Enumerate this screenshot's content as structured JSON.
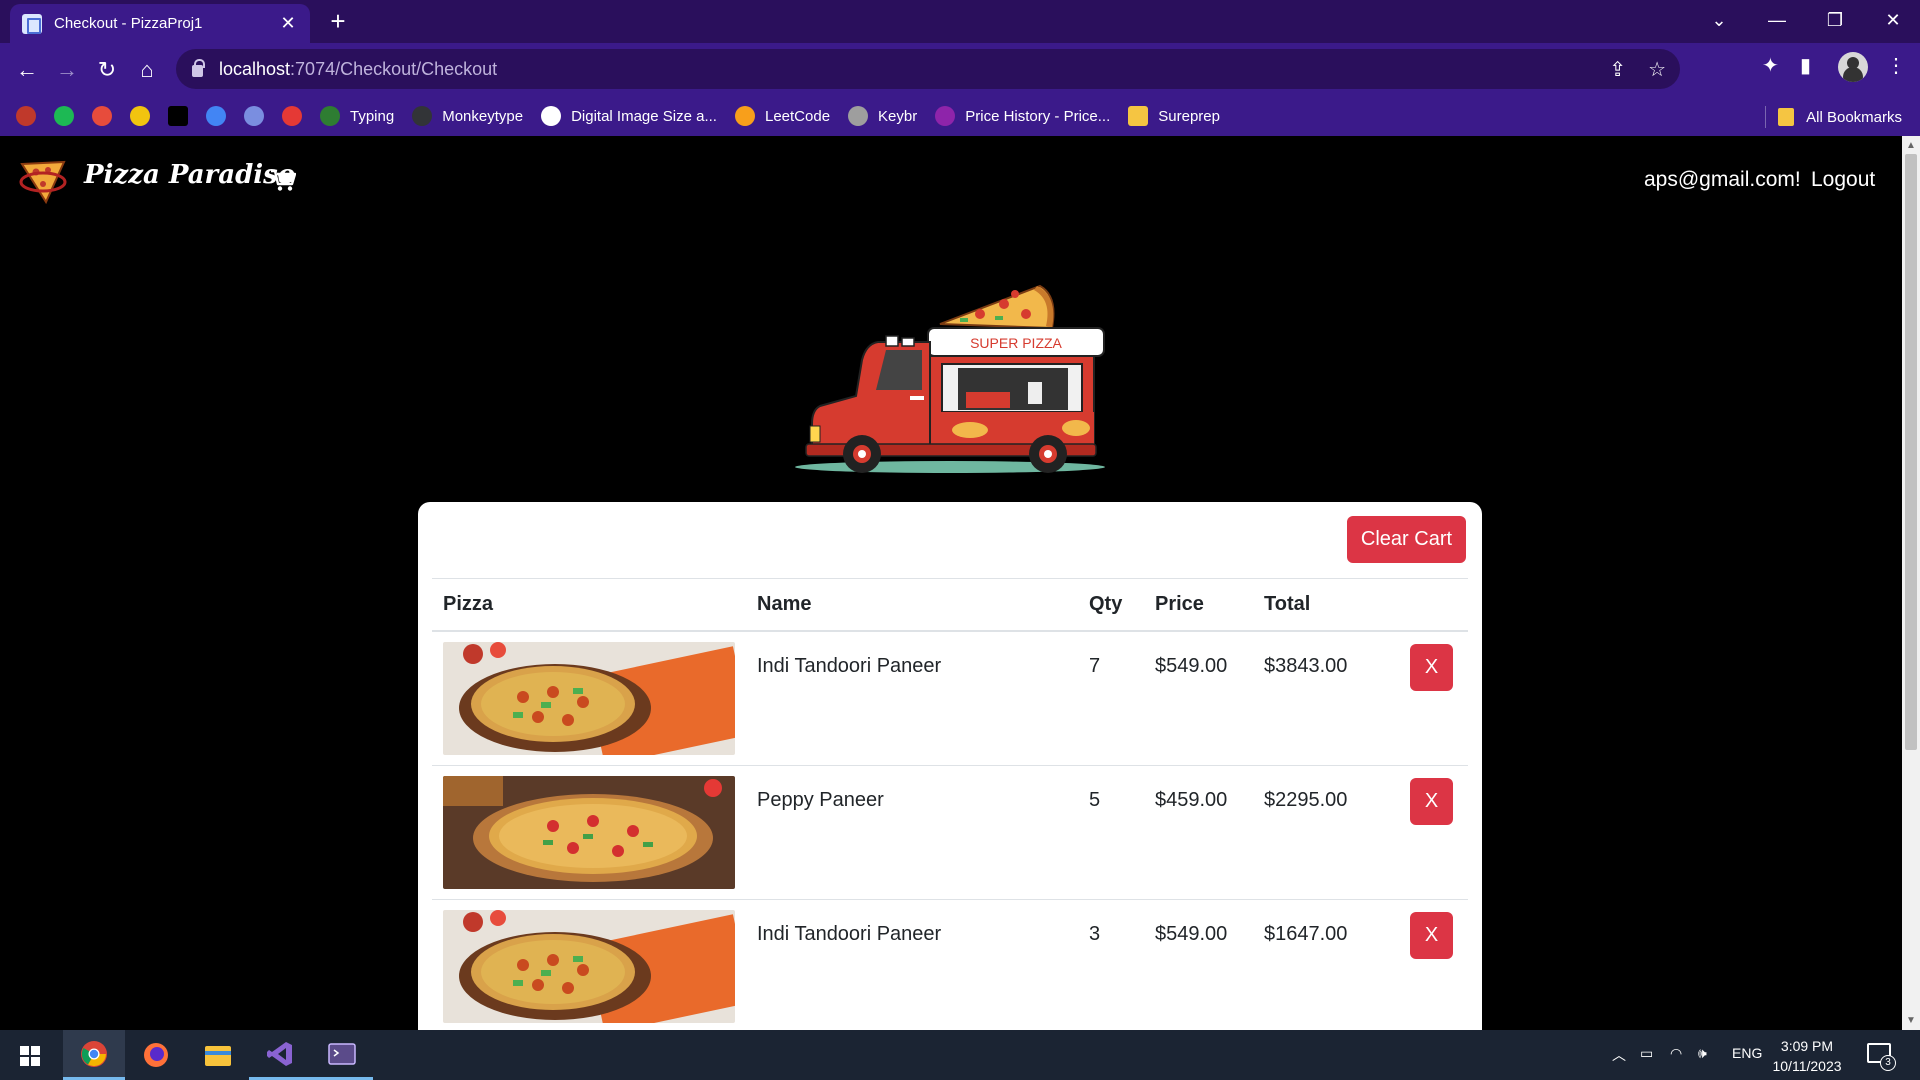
{
  "browser": {
    "tab_title": "Checkout - PizzaProj1",
    "url_host": "localhost",
    "url_path": ":7074/Checkout/Checkout",
    "bookmarks": [
      {
        "label": "",
        "color": "#c0392b",
        "icon": "chevron-icon"
      },
      {
        "label": "",
        "color": "#1db954",
        "icon": "spotify-icon"
      },
      {
        "label": "",
        "color": "#e74c3c",
        "icon": "store-icon"
      },
      {
        "label": "",
        "color": "#f1c40f",
        "icon": "flipkart-icon"
      },
      {
        "label": "",
        "color": "#000000",
        "icon": "amazon-icon"
      },
      {
        "label": "",
        "color": "#4285f4",
        "icon": "gsuite-icon"
      },
      {
        "label": "",
        "color": "#7a8ee0",
        "icon": "drop-icon"
      },
      {
        "label": "",
        "color": "#e53935",
        "icon": "gmail-icon"
      },
      {
        "label": "Typing",
        "color": "#2e7d32",
        "icon": "typing-icon"
      },
      {
        "label": "Monkeytype",
        "color": "#323437",
        "icon": "monkeytype-icon"
      },
      {
        "label": "Digital Image Size a...",
        "color": "#ffffff",
        "icon": "google-icon"
      },
      {
        "label": "LeetCode",
        "color": "#f89f1b",
        "icon": "leetcode-icon"
      },
      {
        "label": "Keybr",
        "color": "#9e9e9e",
        "icon": "keybr-icon"
      },
      {
        "label": "Price History - Price...",
        "color": "#8e24aa",
        "icon": "price-history-icon"
      },
      {
        "label": "Sureprep",
        "color": "#f5c542",
        "icon": "folder-icon"
      }
    ],
    "all_bookmarks": "All Bookmarks"
  },
  "site": {
    "brand": "Pizza Paradiso",
    "user_email": "aps@gmail.com!",
    "logout": "Logout",
    "truck_sign": "SUPER PIZZA"
  },
  "cart": {
    "clear_label": "Clear Cart",
    "columns": [
      "Pizza",
      "Name",
      "Qty",
      "Price",
      "Total",
      ""
    ],
    "rows": [
      {
        "name": "Indi Tandoori Paneer",
        "qty": "7",
        "price": "$549.00",
        "total": "$3843.00",
        "remove": "X"
      },
      {
        "name": "Peppy Paneer",
        "qty": "5",
        "price": "$459.00",
        "total": "$2295.00",
        "remove": "X"
      },
      {
        "name": "Indi Tandoori Paneer",
        "qty": "3",
        "price": "$549.00",
        "total": "$1647.00",
        "remove": "X"
      }
    ]
  },
  "taskbar": {
    "lang": "ENG",
    "time": "3:09 PM",
    "date": "10/11/2023",
    "notifications": "3"
  },
  "colors": {
    "browser_frame": "#3b1a8a",
    "danger": "#dc3545",
    "page_bg": "#000000"
  }
}
